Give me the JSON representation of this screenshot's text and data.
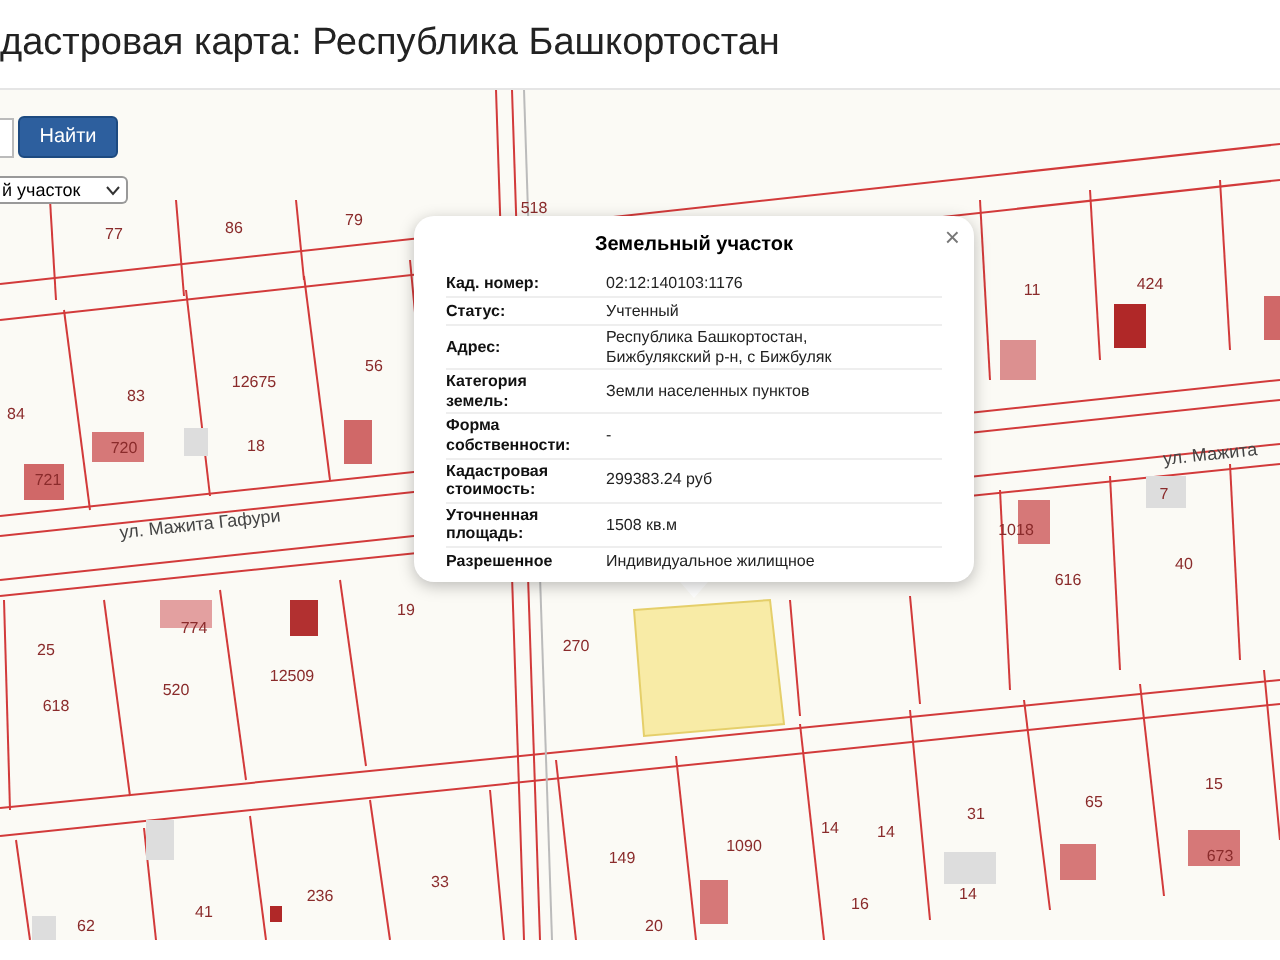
{
  "page": {
    "title": "дастровая карта: Республика Башкортостан"
  },
  "search": {
    "button": "Найти"
  },
  "layer_select": {
    "value": "й участок"
  },
  "map": {
    "streets": [
      "ул. Мажита Гафури",
      "ул. Мажита"
    ],
    "parcel_labels": [
      "77",
      "86",
      "79",
      "518",
      "84",
      "83",
      "12675",
      "56",
      "18",
      "720",
      "721",
      "11",
      "424",
      "7",
      "616",
      "40",
      "1018",
      "25",
      "618",
      "520",
      "12509",
      "19",
      "774",
      "270",
      "149",
      "1090",
      "14",
      "14",
      "16",
      "31",
      "65",
      "15",
      "14",
      "20",
      "62",
      "41",
      "236",
      "33",
      "673"
    ]
  },
  "popup": {
    "title": "Земельный участок",
    "close": "×",
    "rows": [
      {
        "label": "Кад. номер:",
        "value": "02:12:140103:1176"
      },
      {
        "label": "Статус:",
        "value": "Учтенный"
      },
      {
        "label": "Адрес:",
        "value": "Республика Башкортостан, Бижбулякский р-н, с Бижбуляк"
      },
      {
        "label": "Категория земель:",
        "value": "Земли населенных пунктов"
      },
      {
        "label": "Форма собственности:",
        "value": "-"
      },
      {
        "label": "Кадастровая стоимость:",
        "value": "299383.24 руб"
      },
      {
        "label": "Уточненная площадь:",
        "value": "1508 кв.м"
      },
      {
        "label": "Разрешенное",
        "value": "Индивидуальное жилищное"
      }
    ]
  }
}
